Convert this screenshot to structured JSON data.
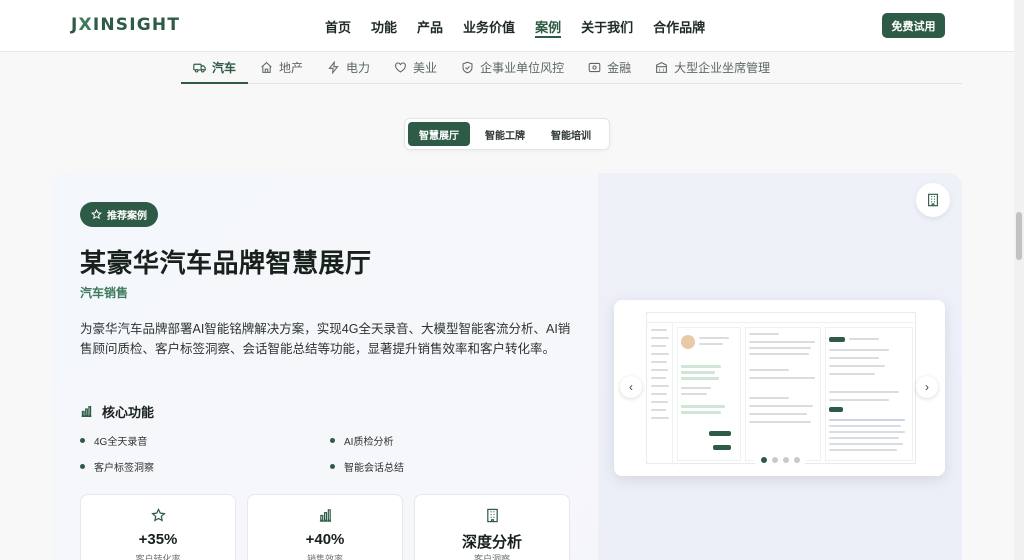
{
  "header": {
    "logo": {
      "part1": "J",
      "x": "X",
      "part2": "INSIGHT"
    },
    "nav": [
      {
        "label": "首页",
        "name": "nav-home"
      },
      {
        "label": "功能",
        "name": "nav-features"
      },
      {
        "label": "产品",
        "name": "nav-products"
      },
      {
        "label": "业务价值",
        "name": "nav-business-value"
      },
      {
        "label": "案例",
        "name": "nav-cases",
        "active": true
      },
      {
        "label": "关于我们",
        "name": "nav-about"
      },
      {
        "label": "合作品牌",
        "name": "nav-partners"
      }
    ],
    "cta": "免费试用"
  },
  "industry_tabs": [
    {
      "label": "汽车",
      "icon": "truck-icon",
      "active": true
    },
    {
      "label": "地产",
      "icon": "home-icon"
    },
    {
      "label": "电力",
      "icon": "bolt-icon"
    },
    {
      "label": "美业",
      "icon": "heart-icon"
    },
    {
      "label": "企事业单位风控",
      "icon": "shield-icon"
    },
    {
      "label": "金融",
      "icon": "bank-card-icon"
    },
    {
      "label": "大型企业坐席管理",
      "icon": "building-icon"
    }
  ],
  "segments": [
    {
      "label": "智慧展厅",
      "active": true
    },
    {
      "label": "智能工牌"
    },
    {
      "label": "智能培训"
    }
  ],
  "case": {
    "badge": "推荐案例",
    "title": "某豪华汽车品牌智慧展厅",
    "subtitle": "汽车销售",
    "description": "为豪华汽车品牌部署AI智能铭牌解决方案，实现4G全天录音、大模型智能客流分析、AI销售顾问质检、客户标签洞察、会话智能总结等功能，显著提升销售效率和客户转化率。",
    "features_title": "核心功能",
    "features": [
      "4G全天录音",
      "AI质检分析",
      "客户标签洞察",
      "智能会话总结"
    ],
    "stats": [
      {
        "value": "+35%",
        "label": "客户转化率",
        "icon": "star-icon"
      },
      {
        "value": "+40%",
        "label": "销售效率",
        "icon": "bar-chart-icon"
      },
      {
        "value": "深度分析",
        "label": "客户洞察",
        "icon": "building-icon"
      }
    ]
  },
  "carousel": {
    "prev": "‹",
    "next": "›",
    "count": 4,
    "active": 0
  },
  "colors": {
    "brand": "#2e5b45",
    "accent": "#3d7a5c"
  }
}
